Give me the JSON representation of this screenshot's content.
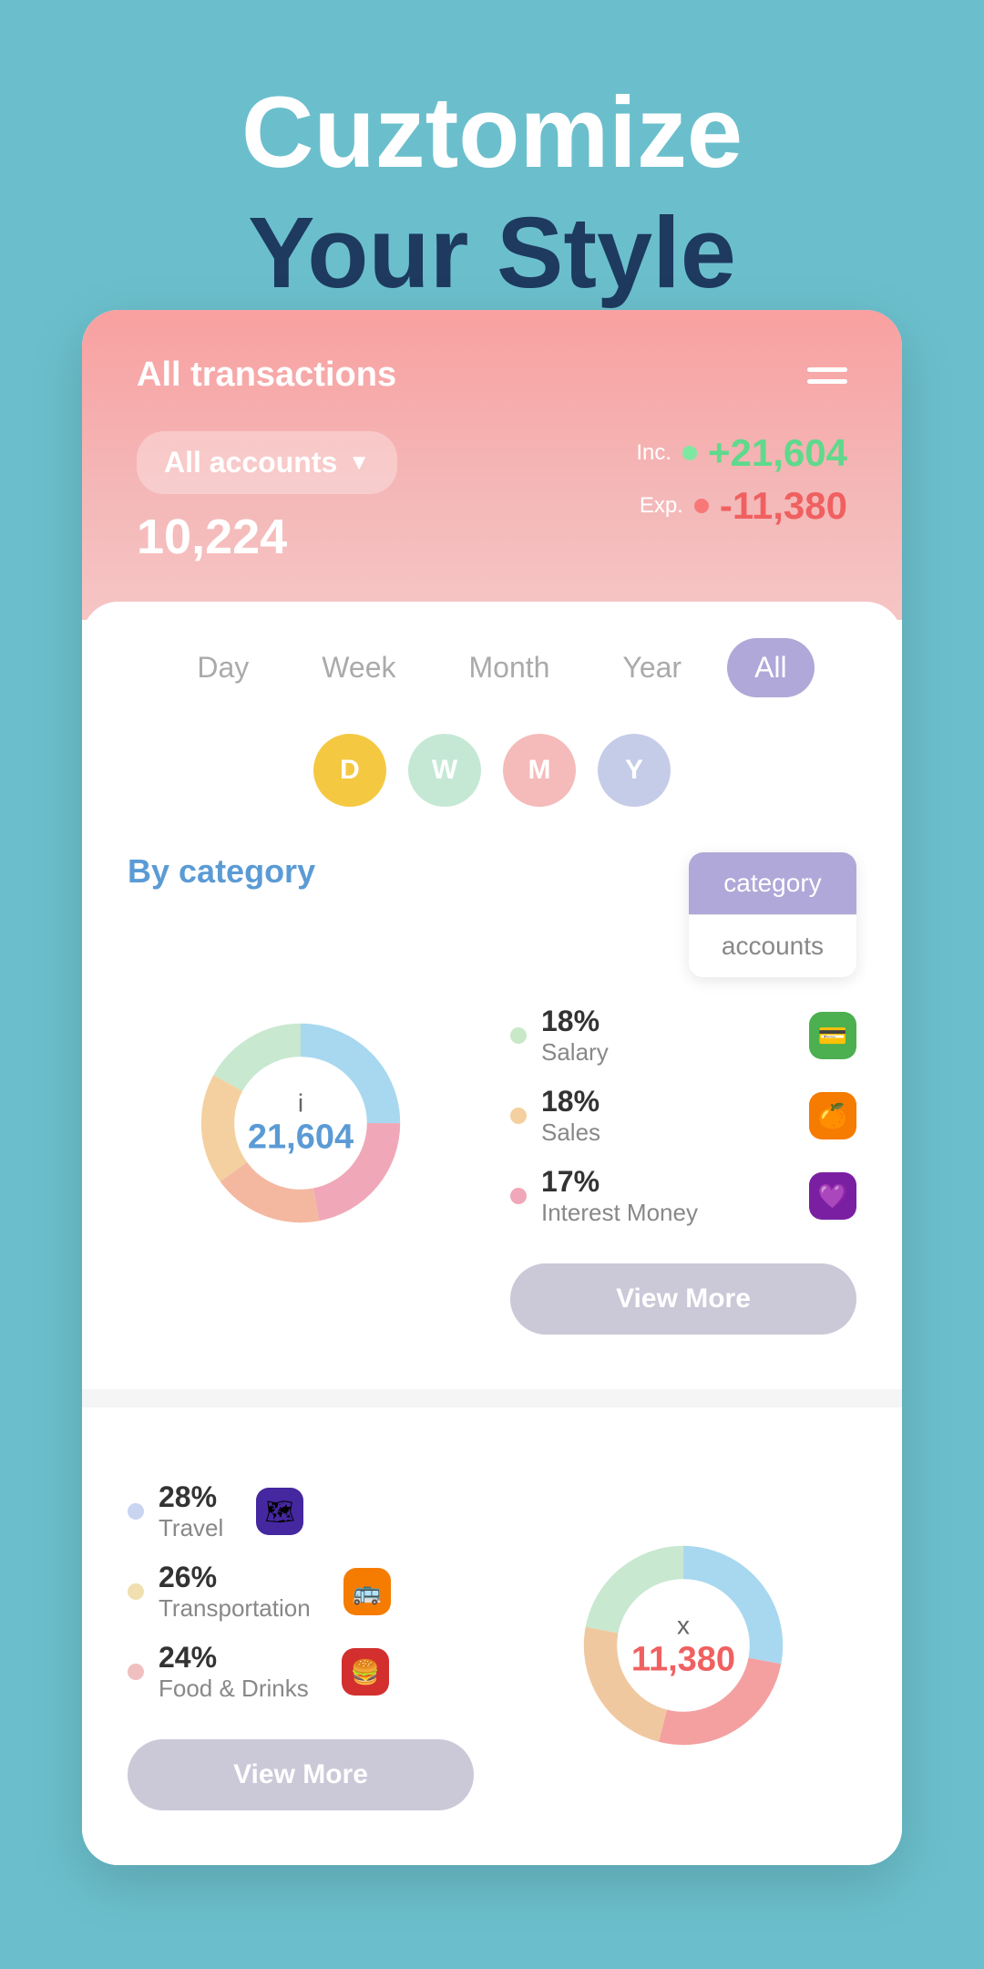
{
  "hero": {
    "line1": "Cuztomize",
    "line2": "Your Style"
  },
  "app": {
    "header": {
      "title": "All transactions",
      "menu_label": "menu",
      "account_selector": "All accounts",
      "balance": "10,224",
      "income": {
        "label": "Inc.",
        "value": "+21,604"
      },
      "expense": {
        "label": "Exp.",
        "value": "-11,380"
      }
    },
    "period_tabs": [
      {
        "label": "Day",
        "active": false
      },
      {
        "label": "Week",
        "active": false
      },
      {
        "label": "Month",
        "active": false
      },
      {
        "label": "Year",
        "active": false
      },
      {
        "label": "All",
        "active": true
      }
    ],
    "dwmy": [
      {
        "label": "D",
        "color": "#f5c842"
      },
      {
        "label": "W",
        "color": "#c5e8d5"
      },
      {
        "label": "M",
        "color": "#f5baba"
      },
      {
        "label": "Y",
        "color": "#c5cce8"
      }
    ],
    "by_category_label": "By category",
    "dropdown": {
      "option1": "category",
      "option2": "accounts"
    },
    "income_chart": {
      "center_letter": "i",
      "center_value": "21,604",
      "segments": [
        {
          "color": "#f4d0a0",
          "pct": 18
        },
        {
          "color": "#f4b8a0",
          "pct": 18
        },
        {
          "color": "#c8e8d0",
          "pct": 17
        },
        {
          "color": "#a8d8f0",
          "pct": 25
        },
        {
          "color": "#f0a8b8",
          "pct": 22
        }
      ],
      "legend": [
        {
          "pct": "18%",
          "name": "Salary",
          "dot": "#c8e8c8",
          "icon": "💳",
          "bg": "#4caf50"
        },
        {
          "pct": "18%",
          "name": "Sales",
          "dot": "#f4d0a0",
          "icon": "🍊",
          "bg": "#f57c00"
        },
        {
          "pct": "17%",
          "name": "Interest Money",
          "dot": "#f0a8b8",
          "icon": "💜",
          "bg": "#7b1fa2"
        }
      ],
      "view_more": "View More"
    },
    "expense_chart": {
      "center_letter": "x",
      "center_value": "11,380",
      "segments": [
        {
          "color": "#f4a0a0",
          "pct": 28
        },
        {
          "color": "#a8d8f0",
          "pct": 26
        },
        {
          "color": "#f0c8a0",
          "pct": 24
        },
        {
          "color": "#c8e8d0",
          "pct": 22
        }
      ],
      "legend": [
        {
          "pct": "28%",
          "name": "Travel",
          "dot": "#c8d4f0",
          "icon": "🗺",
          "bg": "#4527a0"
        },
        {
          "pct": "26%",
          "name": "Transportation",
          "dot": "#f0e0b0",
          "icon": "🚌",
          "bg": "#f57c00"
        },
        {
          "pct": "24%",
          "name": "Food & Drinks",
          "dot": "#f0c0c0",
          "icon": "🍔",
          "bg": "#d32f2f"
        }
      ],
      "view_more": "View More"
    }
  }
}
